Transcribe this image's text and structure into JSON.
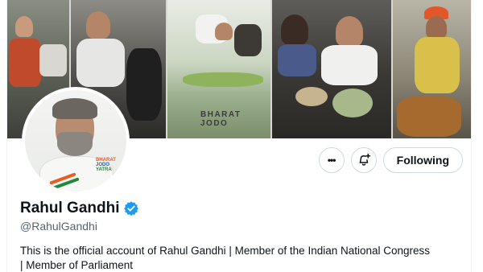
{
  "banner": {
    "caption": "BHARAT JODO",
    "avatar_logo_text": [
      "BHARAT",
      "JODO",
      "YATRA"
    ]
  },
  "actions": {
    "more_label": "•••",
    "notify_label": "+",
    "follow_label": "Following"
  },
  "profile": {
    "name": "Rahul Gandhi",
    "handle": "@RahulGandhi",
    "bio_line1": "This is the official account of Rahul Gandhi | Member of the Indian National Congress",
    "bio_line2": "| Member of Parliament"
  },
  "colors": {
    "verified": "#1d9bf0",
    "text_primary": "#0f1419",
    "text_secondary": "#536471",
    "border": "#cfd9de"
  },
  "icons": {
    "more": "ellipsis-icon",
    "notify": "bell-plus-icon",
    "verified": "verified-badge-icon"
  }
}
